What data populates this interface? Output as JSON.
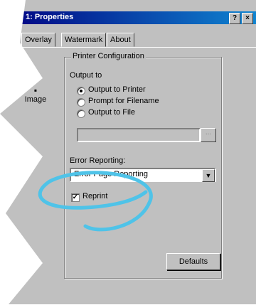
{
  "window": {
    "title": "1: Properties",
    "help_btn": "?",
    "close_btn": "×"
  },
  "tabs": [
    {
      "label": "Overlay"
    },
    {
      "label": "Watermark"
    },
    {
      "label": "About"
    }
  ],
  "side": {
    "icon_label": "Image"
  },
  "printer_config": {
    "legend": "Printer Configuration",
    "output_to": "Output to",
    "options": [
      {
        "label": "Output to Printer",
        "selected": true
      },
      {
        "label": "Prompt for Filename",
        "selected": false
      },
      {
        "label": "Output to File",
        "selected": false
      }
    ],
    "file_path": "",
    "browse_label": "...",
    "error_reporting_label": "Error Reporting:",
    "error_reporting_value": "Error Page Reporting",
    "reprint_label": "Reprint",
    "reprint_checked": true
  },
  "defaults_label": "Defaults",
  "colors": {
    "accent": "#000080",
    "annotation": "#4fc3e8",
    "dialog": "#c0c0c0"
  }
}
